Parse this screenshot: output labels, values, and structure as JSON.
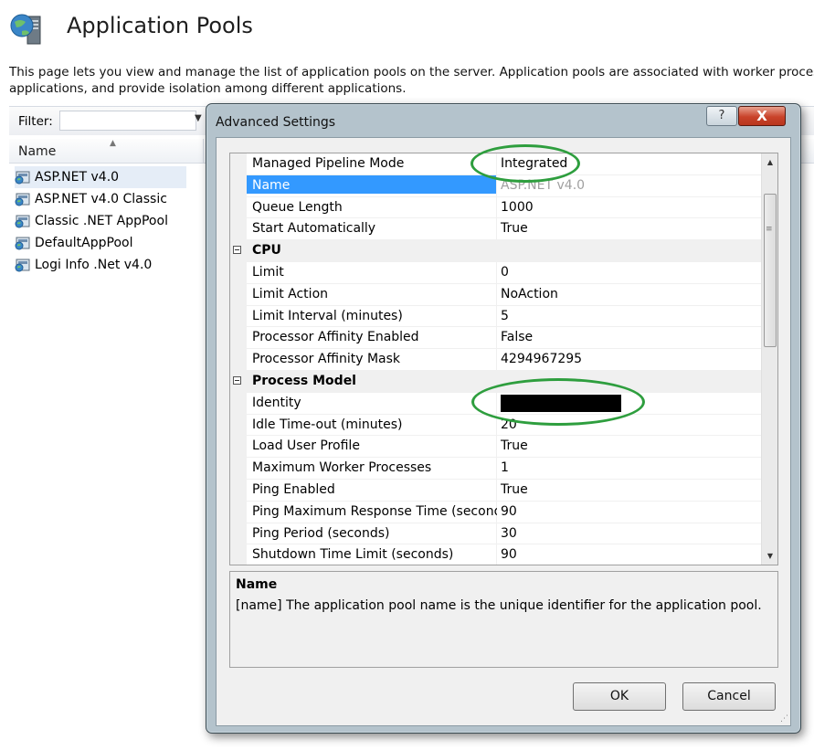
{
  "page": {
    "title": "Application Pools",
    "description_line1": "This page lets you view and manage the list of application pools on the server. Application pools are associated with worker processes",
    "description_line2": "applications, and provide isolation among different applications.",
    "filter_label": "Filter:",
    "filter_value": "",
    "column_name": "Name",
    "pools": [
      {
        "name": "ASP.NET v4.0",
        "selected": true
      },
      {
        "name": "ASP.NET v4.0 Classic"
      },
      {
        "name": "Classic .NET AppPool"
      },
      {
        "name": "DefaultAppPool"
      },
      {
        "name": "Logi Info .Net v4.0"
      }
    ]
  },
  "dialog": {
    "title": "Advanced Settings",
    "help_label": "?",
    "close_label": "X",
    "rows": [
      {
        "name": "Managed Pipeline Mode",
        "value": "Integrated"
      },
      {
        "name": "Name",
        "value": "ASP.NET v4.0",
        "selected": true
      },
      {
        "name": "Queue Length",
        "value": "1000"
      },
      {
        "name": "Start Automatically",
        "value": "True"
      },
      {
        "category": true,
        "name": "CPU"
      },
      {
        "name": "Limit",
        "value": "0"
      },
      {
        "name": "Limit Action",
        "value": "NoAction"
      },
      {
        "name": "Limit Interval (minutes)",
        "value": "5"
      },
      {
        "name": "Processor Affinity Enabled",
        "value": "False"
      },
      {
        "name": "Processor Affinity Mask",
        "value": "4294967295"
      },
      {
        "category": true,
        "name": "Process Model"
      },
      {
        "name": "Identity",
        "value": "",
        "redacted": true
      },
      {
        "name": "Idle Time-out (minutes)",
        "value": "20"
      },
      {
        "name": "Load User Profile",
        "value": "True"
      },
      {
        "name": "Maximum Worker Processes",
        "value": "1"
      },
      {
        "name": "Ping Enabled",
        "value": "True"
      },
      {
        "name": "Ping Maximum Response Time (seconds)",
        "value": "90"
      },
      {
        "name": "Ping Period (seconds)",
        "value": "30"
      },
      {
        "name": "Shutdown Time Limit (seconds)",
        "value": "90"
      }
    ],
    "description_title": "Name",
    "description_text": "[name] The application pool name is the unique identifier for the application pool.",
    "ok_label": "OK",
    "cancel_label": "Cancel"
  },
  "colors": {
    "selection": "#3399ff",
    "annotation": "#2e9e3e",
    "close_button": "#c9432a"
  }
}
